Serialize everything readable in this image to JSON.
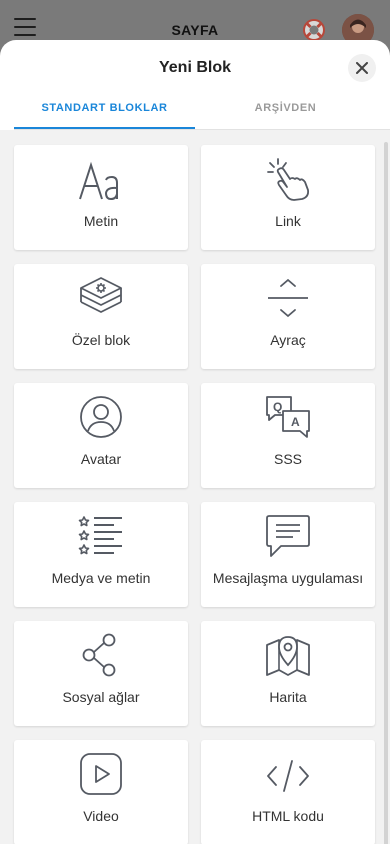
{
  "app": {
    "title": "SAYFA"
  },
  "sheet": {
    "title": "Yeni Blok",
    "tabs": [
      {
        "label": "STANDART BLOKLAR",
        "active": true
      },
      {
        "label": "ARŞİVDEN",
        "active": false
      }
    ]
  },
  "blocks": [
    {
      "label": "Metin",
      "icon": "text-icon"
    },
    {
      "label": "Link",
      "icon": "link-tap-icon"
    },
    {
      "label": "Özel blok",
      "icon": "custom-block-icon"
    },
    {
      "label": "Ayraç",
      "icon": "divider-icon"
    },
    {
      "label": "Avatar",
      "icon": "avatar-icon"
    },
    {
      "label": "SSS",
      "icon": "faq-icon"
    },
    {
      "label": "Medya ve metin",
      "icon": "media-text-icon"
    },
    {
      "label": "Mesajlaşma uygulaması",
      "icon": "messenger-icon"
    },
    {
      "label": "Sosyal ağlar",
      "icon": "share-icon"
    },
    {
      "label": "Harita",
      "icon": "map-icon"
    },
    {
      "label": "Video",
      "icon": "video-icon"
    },
    {
      "label": "HTML kodu",
      "icon": "code-icon"
    }
  ],
  "colors": {
    "accent": "#1a86d9",
    "icon": "#555a63"
  }
}
